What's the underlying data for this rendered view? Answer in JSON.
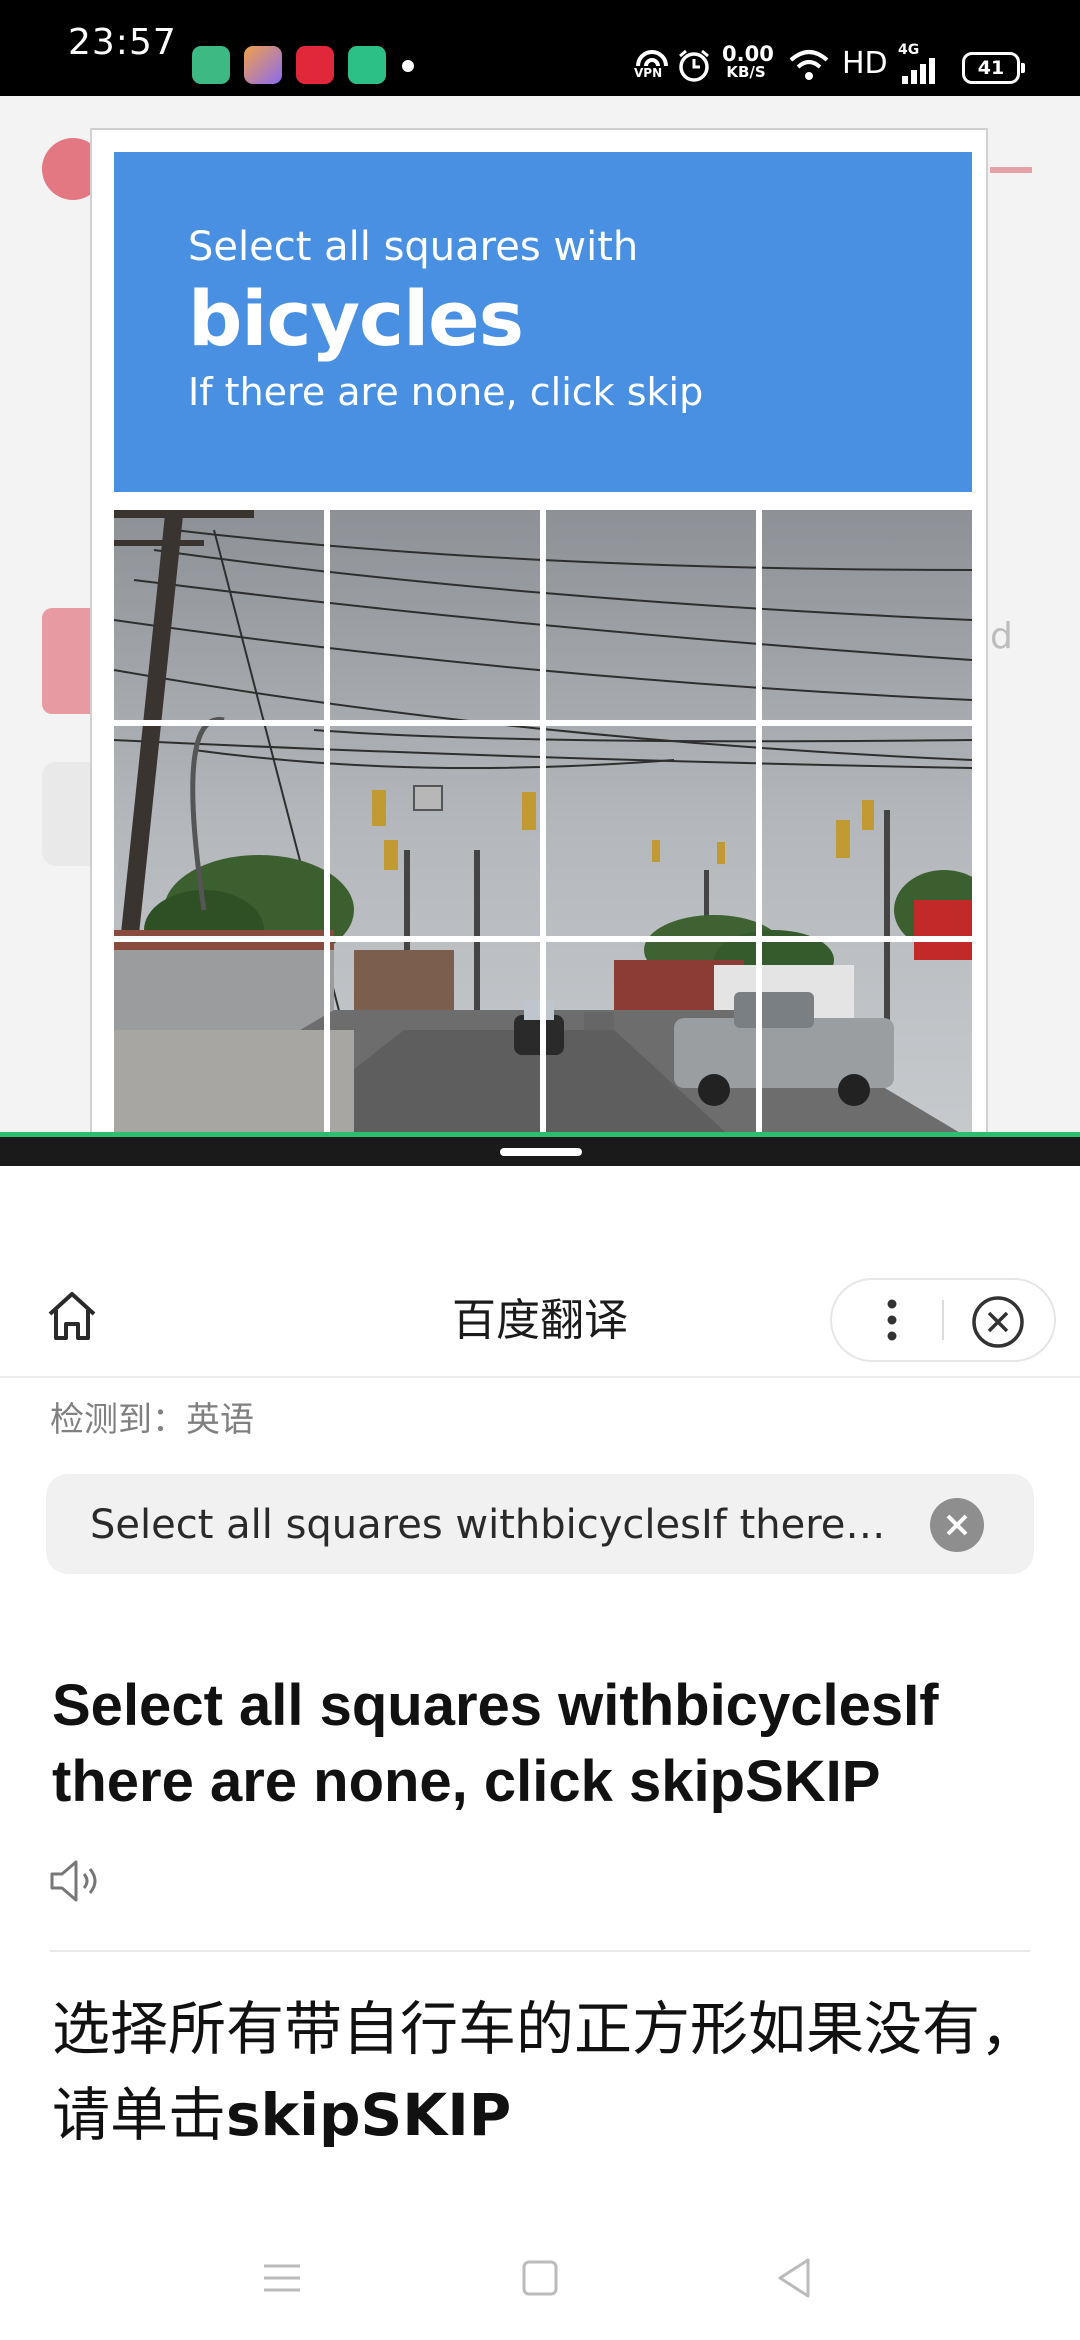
{
  "status_bar": {
    "time": "23:57",
    "net_speed_value": "0.00",
    "net_speed_unit": "KB/S",
    "vpn": "VPN",
    "hd": "HD",
    "network": "4G",
    "battery": "41",
    "app_icons": [
      {
        "name": "green-app-icon",
        "color": "#3dba84"
      },
      {
        "name": "shortcut-app-icon",
        "color": "#8a6bf0"
      },
      {
        "name": "red-app-icon",
        "color": "#e0283a"
      },
      {
        "name": "message-app-icon",
        "color": "#2cc086"
      }
    ]
  },
  "background_app": {
    "partial_text": "d",
    "accent_color": "#e37882"
  },
  "captcha": {
    "instruction_line": "Select all squares with",
    "target_word": "bicycles",
    "skip_hint": "If there are none, click skip",
    "header_color": "#4a90e2",
    "grid": {
      "rows": 3,
      "cols": 4,
      "visible_rows": 3
    }
  },
  "translator": {
    "title": "百度翻译",
    "detected_label": "检测到：英语",
    "input_text": "Select all squares withbicyclesIf there are none, click skipSKIP",
    "source_text": "Select all squares withbicyclesIf there are none, click skipSKIP",
    "result_text_zh": "选择所有带自行车的正方形如果没有，请单击",
    "result_text_en": "skipSKIP"
  },
  "icons": {
    "home": "home-icon",
    "more": "more-vertical-icon",
    "close": "close-circle-icon",
    "clear": "clear-input-icon",
    "speaker": "speaker-icon",
    "nav_menu": "menu-icon",
    "nav_home": "square-home-icon",
    "nav_back": "back-triangle-icon"
  }
}
